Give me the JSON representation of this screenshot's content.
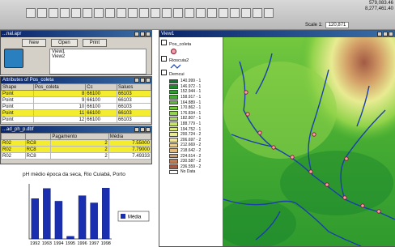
{
  "toolbar": {
    "scale_label": "Scale 1:",
    "scale_value": "120,871",
    "coord_x": "579,083.46",
    "coord_y": "8,277,461.40"
  },
  "project_window": {
    "title": "...nal.apr",
    "buttons": [
      "New",
      "Open",
      "Print"
    ],
    "views": [
      "View1",
      "View2"
    ]
  },
  "attr_table_1": {
    "title": "Attributes of Pos_coleta",
    "columns": [
      "Shape",
      "Pos_coleta",
      "Cc",
      "Saluos"
    ],
    "rows": [
      {
        "shape": "Point",
        "id": "8",
        "cc": "66100",
        "sal": "66103",
        "hl": true
      },
      {
        "shape": "Point",
        "id": "9",
        "cc": "66100",
        "sal": "66103",
        "hl": false
      },
      {
        "shape": "Point",
        "id": "10",
        "cc": "66100",
        "sal": "66103",
        "hl": false
      },
      {
        "shape": "Point",
        "id": "11",
        "cc": "66100",
        "sal": "66103",
        "hl": true
      },
      {
        "shape": "Point",
        "id": "12",
        "cc": "66100",
        "sal": "66103",
        "hl": false
      }
    ]
  },
  "attr_table_2": {
    "title": "...ad_ph_p.dbf",
    "columns": [
      "",
      "",
      "Pagamento",
      "Média"
    ],
    "rows": [
      {
        "a": "R02",
        "b": "RC8",
        "c": "2",
        "d": "7.55000",
        "hl": true
      },
      {
        "a": "R02",
        "b": "RC8",
        "c": "2",
        "d": "7.79000",
        "hl": true
      },
      {
        "a": "R02",
        "b": "RC8",
        "c": "2",
        "d": "7.49333",
        "hl": false
      }
    ]
  },
  "chart_data": {
    "type": "bar",
    "title": "pH médio época da seca, Rio Cuiabá, Porto",
    "categories": [
      "1992",
      "1993",
      "1994",
      "1995",
      "1996",
      "1997",
      "1998"
    ],
    "values": [
      7.55,
      7.79,
      7.49,
      6.66,
      7.62,
      7.45,
      7.8
    ],
    "ylim": [
      6.6,
      7.9
    ],
    "legend": "Média",
    "color": "#1a2fb0"
  },
  "view_window": {
    "title": "View1",
    "layers": [
      {
        "name": "Pos_coleta"
      },
      {
        "name": "Rioscuia2"
      },
      {
        "name": "Demcui"
      }
    ],
    "legend": [
      {
        "label": "140.999 - 1",
        "color": "#0d7a2b"
      },
      {
        "label": "146.972 - 1",
        "color": "#1c8a2c"
      },
      {
        "label": "152.944 - 1",
        "color": "#2f9a2e"
      },
      {
        "label": "158.917 - 1",
        "color": "#45ab32"
      },
      {
        "label": "164.889 - 1",
        "color": "#5cbb37"
      },
      {
        "label": "170.862 - 1",
        "color": "#75c83f"
      },
      {
        "label": "176.834 - 1",
        "color": "#91d34a"
      },
      {
        "label": "182.807 - 1",
        "color": "#acdd59"
      },
      {
        "label": "188.779 - 1",
        "color": "#c4e46b"
      },
      {
        "label": "194.752 - 1",
        "color": "#d9ea80"
      },
      {
        "label": "200.724 - 2",
        "color": "#e8eb92"
      },
      {
        "label": "206.697 - 2",
        "color": "#efe49a"
      },
      {
        "label": "212.669 - 2",
        "color": "#ecd28e"
      },
      {
        "label": "218.642 - 2",
        "color": "#e2ba7a"
      },
      {
        "label": "224.614 - 2",
        "color": "#d29c66"
      },
      {
        "label": "230.587 - 2",
        "color": "#bf7d55"
      },
      {
        "label": "236.559 - 2",
        "color": "#a35a44"
      },
      {
        "label": "No Data",
        "color": "#ffffff"
      }
    ]
  }
}
